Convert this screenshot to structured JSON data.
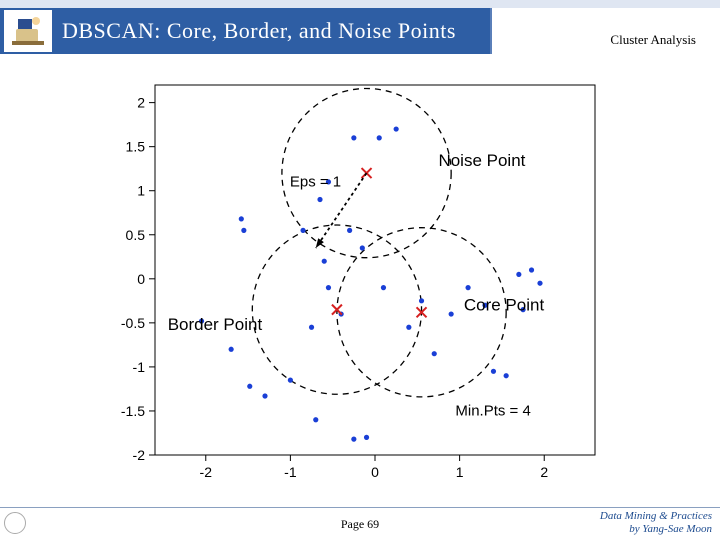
{
  "header": {
    "title": "DBSCAN: Core, Border, and Noise Points",
    "subject": "Cluster Analysis"
  },
  "footer": {
    "page": "Page 69",
    "credit1": "Data Mining & Practices",
    "credit2": "by Yang-Sae Moon"
  },
  "chart_data": {
    "type": "scatter",
    "title": "",
    "xlabel": "",
    "ylabel": "",
    "xlim": [
      -2.6,
      2.6
    ],
    "ylim": [
      -2.0,
      2.2
    ],
    "xticks": [
      -2,
      -1,
      0,
      1,
      2
    ],
    "yticks": [
      -2,
      -1.5,
      -1,
      -0.5,
      0,
      0.5,
      1,
      1.5,
      2
    ],
    "points": [
      [
        -2.05,
        -0.48
      ],
      [
        -1.7,
        -0.8
      ],
      [
        -1.48,
        -1.22
      ],
      [
        -1.55,
        0.55
      ],
      [
        -1.58,
        0.68
      ],
      [
        -1.0,
        -1.15
      ],
      [
        -1.3,
        -1.33
      ],
      [
        -0.7,
        -1.6
      ],
      [
        -0.25,
        -1.82
      ],
      [
        -0.1,
        -1.8
      ],
      [
        -0.75,
        -0.55
      ],
      [
        -0.4,
        -0.4
      ],
      [
        -0.55,
        -0.1
      ],
      [
        -0.6,
        0.2
      ],
      [
        -0.85,
        0.55
      ],
      [
        -0.3,
        0.55
      ],
      [
        -0.15,
        0.35
      ],
      [
        0.1,
        -0.1
      ],
      [
        0.4,
        -0.55
      ],
      [
        0.7,
        -0.85
      ],
      [
        0.55,
        -0.25
      ],
      [
        0.9,
        -0.4
      ],
      [
        1.1,
        -0.1
      ],
      [
        1.3,
        -0.3
      ],
      [
        1.4,
        -1.05
      ],
      [
        1.55,
        -1.1
      ],
      [
        1.75,
        -0.35
      ],
      [
        1.95,
        -0.05
      ],
      [
        1.7,
        0.05
      ],
      [
        1.85,
        0.1
      ],
      [
        0.25,
        1.7
      ],
      [
        0.05,
        1.6
      ],
      [
        -0.25,
        1.6
      ],
      [
        -0.55,
        1.1
      ],
      [
        -0.65,
        0.9
      ]
    ],
    "marked": [
      {
        "name": "noise",
        "x": -0.1,
        "y": 1.2
      },
      {
        "name": "border",
        "x": -0.45,
        "y": -0.35
      },
      {
        "name": "core",
        "x": 0.55,
        "y": -0.38
      }
    ],
    "circles": [
      {
        "cx": -0.1,
        "cy": 1.2,
        "r": 1.0
      },
      {
        "cx": -0.45,
        "cy": -0.35,
        "r": 1.0
      },
      {
        "cx": 0.55,
        "cy": -0.38,
        "r": 1.0
      }
    ],
    "arrow": {
      "from": [
        -0.1,
        1.2
      ],
      "to": [
        -0.7,
        0.35
      ]
    },
    "labels": {
      "eps": "Eps = 1",
      "noise": "Noise Point",
      "border": "Border Point",
      "core": "Core Point",
      "minpts": "Min.Pts = 4"
    }
  }
}
